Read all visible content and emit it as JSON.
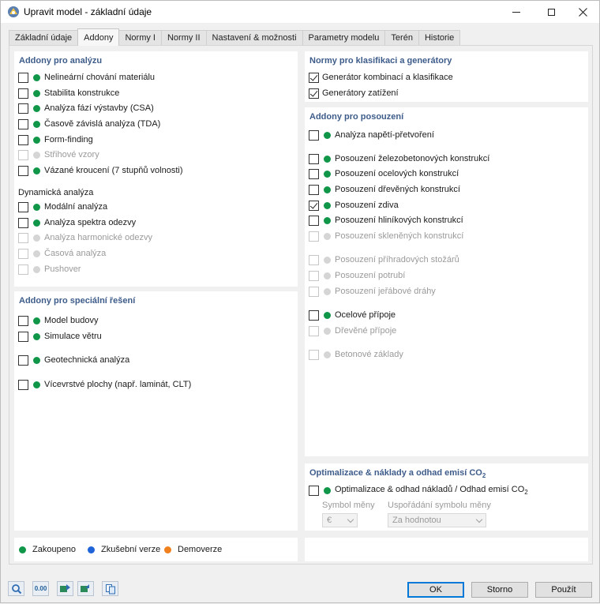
{
  "window": {
    "title": "Upravit model - základní údaje"
  },
  "tabs": [
    "Základní údaje",
    "Addony",
    "Normy I",
    "Normy II",
    "Nastavení & možnosti",
    "Parametry modelu",
    "Terén",
    "Historie"
  ],
  "analysis_addons": {
    "title": "Addony pro analýzu",
    "items": [
      {
        "label": "Nelineární chování materiálu",
        "enabled": true
      },
      {
        "label": "Stabilita konstrukce",
        "enabled": true
      },
      {
        "label": "Analýza fází výstavby (CSA)",
        "enabled": true
      },
      {
        "label": "Časově závislá analýza (TDA)",
        "enabled": true
      },
      {
        "label": "Form-finding",
        "enabled": true
      },
      {
        "label": "Střihové vzory",
        "enabled": false
      },
      {
        "label": "Vázané kroucení (7 stupňů volnosti)",
        "enabled": true
      }
    ],
    "dynamic_title": "Dynamická analýza",
    "dynamic_items": [
      {
        "label": "Modální analýza",
        "enabled": true
      },
      {
        "label": "Analýza spektra odezvy",
        "enabled": true
      },
      {
        "label": "Analýza harmonické odezvy",
        "enabled": false
      },
      {
        "label": "Časová analýza",
        "enabled": false
      },
      {
        "label": "Pushover",
        "enabled": false
      }
    ]
  },
  "special_addons": {
    "title": "Addony pro speciální řešení",
    "items": [
      {
        "label": "Model budovy",
        "enabled": true
      },
      {
        "label": "Simulace větru",
        "enabled": true
      },
      {
        "label": "Geotechnická analýza",
        "enabled": true
      },
      {
        "label": "Vícevrstvé plochy (např. laminát, CLT)",
        "enabled": true
      }
    ]
  },
  "standards": {
    "title": "Normy pro klasifikaci a generátory",
    "items": [
      {
        "label": "Generátor kombinací a klasifikace",
        "checked": true
      },
      {
        "label": "Generátory zatížení",
        "checked": true
      }
    ]
  },
  "design_addons": {
    "title": "Addony pro posouzení",
    "items": [
      {
        "label": "Analýza napětí-přetvoření",
        "enabled": true,
        "checked": false
      },
      {
        "label": "Posouzení železobetonových konstrukcí",
        "enabled": true,
        "checked": false
      },
      {
        "label": "Posouzení ocelových konstrukcí",
        "enabled": true,
        "checked": false
      },
      {
        "label": "Posouzení dřevěných konstrukcí",
        "enabled": true,
        "checked": false
      },
      {
        "label": "Posouzení zdiva",
        "enabled": true,
        "checked": true
      },
      {
        "label": "Posouzení hliníkových konstrukcí",
        "enabled": true,
        "checked": false
      },
      {
        "label": "Posouzení skleněných konstrukcí",
        "enabled": false,
        "checked": false
      },
      {
        "label": "Posouzení příhradových stožárů",
        "enabled": false,
        "checked": false
      },
      {
        "label": "Posouzení potrubí",
        "enabled": false,
        "checked": false
      },
      {
        "label": "Posouzení jeřábové dráhy",
        "enabled": false,
        "checked": false
      },
      {
        "label": "Ocelové přípoje",
        "enabled": true,
        "checked": false
      },
      {
        "label": "Dřevěné přípoje",
        "enabled": false,
        "checked": false
      },
      {
        "label": "Betonové základy",
        "enabled": false,
        "checked": false
      }
    ]
  },
  "optimization": {
    "title_main": "Optimalizace & náklady a odhad emisí CO",
    "title_sub": "2",
    "item_main": "Optimalizace & odhad nákladů / Odhad emisí CO",
    "item_sub": "2",
    "currency_label": "Symbol měny",
    "currency_value": "€",
    "arrangement_label": "Uspořádání symbolu měny",
    "arrangement_value": "Za hodnotou"
  },
  "legend": {
    "purchased": "Zakoupeno",
    "trial": "Zkušební verze",
    "demo": "Demoverze"
  },
  "buttons": {
    "ok": "OK",
    "cancel": "Storno",
    "apply": "Použít"
  },
  "toolbar": {
    "units_label": "0.00"
  },
  "colors": {
    "purchased": "#109648",
    "trial": "#1f63d8",
    "demo": "#f07f1e",
    "section_title": "#3e5c8a"
  }
}
